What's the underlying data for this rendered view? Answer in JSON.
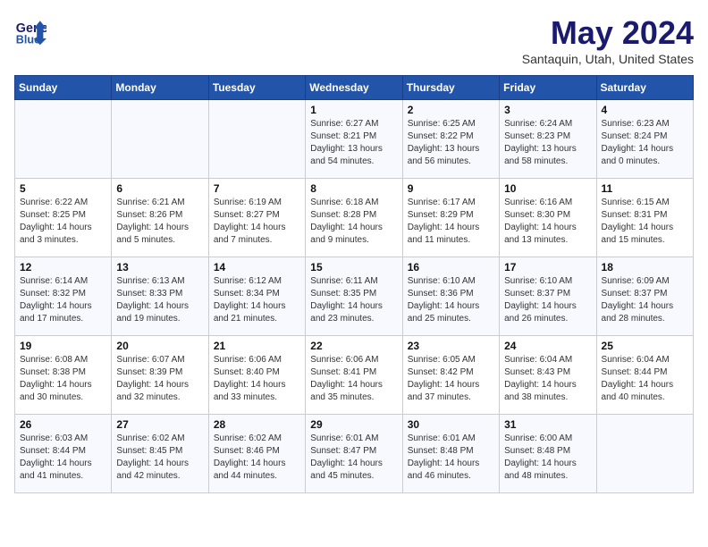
{
  "header": {
    "logo_line1": "General",
    "logo_line2": "Blue",
    "month": "May 2024",
    "location": "Santaquin, Utah, United States"
  },
  "weekdays": [
    "Sunday",
    "Monday",
    "Tuesday",
    "Wednesday",
    "Thursday",
    "Friday",
    "Saturday"
  ],
  "weeks": [
    [
      {
        "day": "",
        "sunrise": "",
        "sunset": "",
        "daylight": ""
      },
      {
        "day": "",
        "sunrise": "",
        "sunset": "",
        "daylight": ""
      },
      {
        "day": "",
        "sunrise": "",
        "sunset": "",
        "daylight": ""
      },
      {
        "day": "1",
        "sunrise": "Sunrise: 6:27 AM",
        "sunset": "Sunset: 8:21 PM",
        "daylight": "Daylight: 13 hours and 54 minutes."
      },
      {
        "day": "2",
        "sunrise": "Sunrise: 6:25 AM",
        "sunset": "Sunset: 8:22 PM",
        "daylight": "Daylight: 13 hours and 56 minutes."
      },
      {
        "day": "3",
        "sunrise": "Sunrise: 6:24 AM",
        "sunset": "Sunset: 8:23 PM",
        "daylight": "Daylight: 13 hours and 58 minutes."
      },
      {
        "day": "4",
        "sunrise": "Sunrise: 6:23 AM",
        "sunset": "Sunset: 8:24 PM",
        "daylight": "Daylight: 14 hours and 0 minutes."
      }
    ],
    [
      {
        "day": "5",
        "sunrise": "Sunrise: 6:22 AM",
        "sunset": "Sunset: 8:25 PM",
        "daylight": "Daylight: 14 hours and 3 minutes."
      },
      {
        "day": "6",
        "sunrise": "Sunrise: 6:21 AM",
        "sunset": "Sunset: 8:26 PM",
        "daylight": "Daylight: 14 hours and 5 minutes."
      },
      {
        "day": "7",
        "sunrise": "Sunrise: 6:19 AM",
        "sunset": "Sunset: 8:27 PM",
        "daylight": "Daylight: 14 hours and 7 minutes."
      },
      {
        "day": "8",
        "sunrise": "Sunrise: 6:18 AM",
        "sunset": "Sunset: 8:28 PM",
        "daylight": "Daylight: 14 hours and 9 minutes."
      },
      {
        "day": "9",
        "sunrise": "Sunrise: 6:17 AM",
        "sunset": "Sunset: 8:29 PM",
        "daylight": "Daylight: 14 hours and 11 minutes."
      },
      {
        "day": "10",
        "sunrise": "Sunrise: 6:16 AM",
        "sunset": "Sunset: 8:30 PM",
        "daylight": "Daylight: 14 hours and 13 minutes."
      },
      {
        "day": "11",
        "sunrise": "Sunrise: 6:15 AM",
        "sunset": "Sunset: 8:31 PM",
        "daylight": "Daylight: 14 hours and 15 minutes."
      }
    ],
    [
      {
        "day": "12",
        "sunrise": "Sunrise: 6:14 AM",
        "sunset": "Sunset: 8:32 PM",
        "daylight": "Daylight: 14 hours and 17 minutes."
      },
      {
        "day": "13",
        "sunrise": "Sunrise: 6:13 AM",
        "sunset": "Sunset: 8:33 PM",
        "daylight": "Daylight: 14 hours and 19 minutes."
      },
      {
        "day": "14",
        "sunrise": "Sunrise: 6:12 AM",
        "sunset": "Sunset: 8:34 PM",
        "daylight": "Daylight: 14 hours and 21 minutes."
      },
      {
        "day": "15",
        "sunrise": "Sunrise: 6:11 AM",
        "sunset": "Sunset: 8:35 PM",
        "daylight": "Daylight: 14 hours and 23 minutes."
      },
      {
        "day": "16",
        "sunrise": "Sunrise: 6:10 AM",
        "sunset": "Sunset: 8:36 PM",
        "daylight": "Daylight: 14 hours and 25 minutes."
      },
      {
        "day": "17",
        "sunrise": "Sunrise: 6:10 AM",
        "sunset": "Sunset: 8:37 PM",
        "daylight": "Daylight: 14 hours and 26 minutes."
      },
      {
        "day": "18",
        "sunrise": "Sunrise: 6:09 AM",
        "sunset": "Sunset: 8:37 PM",
        "daylight": "Daylight: 14 hours and 28 minutes."
      }
    ],
    [
      {
        "day": "19",
        "sunrise": "Sunrise: 6:08 AM",
        "sunset": "Sunset: 8:38 PM",
        "daylight": "Daylight: 14 hours and 30 minutes."
      },
      {
        "day": "20",
        "sunrise": "Sunrise: 6:07 AM",
        "sunset": "Sunset: 8:39 PM",
        "daylight": "Daylight: 14 hours and 32 minutes."
      },
      {
        "day": "21",
        "sunrise": "Sunrise: 6:06 AM",
        "sunset": "Sunset: 8:40 PM",
        "daylight": "Daylight: 14 hours and 33 minutes."
      },
      {
        "day": "22",
        "sunrise": "Sunrise: 6:06 AM",
        "sunset": "Sunset: 8:41 PM",
        "daylight": "Daylight: 14 hours and 35 minutes."
      },
      {
        "day": "23",
        "sunrise": "Sunrise: 6:05 AM",
        "sunset": "Sunset: 8:42 PM",
        "daylight": "Daylight: 14 hours and 37 minutes."
      },
      {
        "day": "24",
        "sunrise": "Sunrise: 6:04 AM",
        "sunset": "Sunset: 8:43 PM",
        "daylight": "Daylight: 14 hours and 38 minutes."
      },
      {
        "day": "25",
        "sunrise": "Sunrise: 6:04 AM",
        "sunset": "Sunset: 8:44 PM",
        "daylight": "Daylight: 14 hours and 40 minutes."
      }
    ],
    [
      {
        "day": "26",
        "sunrise": "Sunrise: 6:03 AM",
        "sunset": "Sunset: 8:44 PM",
        "daylight": "Daylight: 14 hours and 41 minutes."
      },
      {
        "day": "27",
        "sunrise": "Sunrise: 6:02 AM",
        "sunset": "Sunset: 8:45 PM",
        "daylight": "Daylight: 14 hours and 42 minutes."
      },
      {
        "day": "28",
        "sunrise": "Sunrise: 6:02 AM",
        "sunset": "Sunset: 8:46 PM",
        "daylight": "Daylight: 14 hours and 44 minutes."
      },
      {
        "day": "29",
        "sunrise": "Sunrise: 6:01 AM",
        "sunset": "Sunset: 8:47 PM",
        "daylight": "Daylight: 14 hours and 45 minutes."
      },
      {
        "day": "30",
        "sunrise": "Sunrise: 6:01 AM",
        "sunset": "Sunset: 8:48 PM",
        "daylight": "Daylight: 14 hours and 46 minutes."
      },
      {
        "day": "31",
        "sunrise": "Sunrise: 6:00 AM",
        "sunset": "Sunset: 8:48 PM",
        "daylight": "Daylight: 14 hours and 48 minutes."
      },
      {
        "day": "",
        "sunrise": "",
        "sunset": "",
        "daylight": ""
      }
    ]
  ]
}
